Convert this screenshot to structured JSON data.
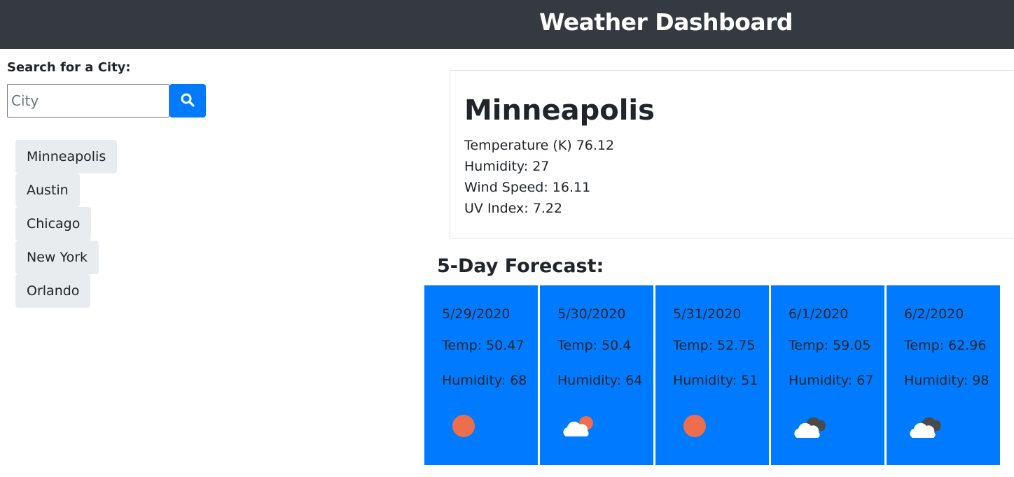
{
  "header": {
    "title": "Weather Dashboard"
  },
  "search": {
    "label": "Search for a City:",
    "placeholder": "City",
    "value": "",
    "button_icon": "search-icon"
  },
  "history": {
    "items": [
      {
        "label": "Minneapolis"
      },
      {
        "label": "Austin"
      },
      {
        "label": "Chicago"
      },
      {
        "label": "New York"
      },
      {
        "label": "Orlando"
      }
    ]
  },
  "current": {
    "city": "Minneapolis",
    "temperature": "Temperature (K) 76.12",
    "humidity": "Humidity: 27",
    "wind": "Wind Speed: 16.11",
    "uv": "UV Index: 7.22"
  },
  "forecast": {
    "title": "5-Day Forecast:",
    "days": [
      {
        "date": "5/29/2020",
        "temp": "Temp: 50.47",
        "humidity": "Humidity: 68",
        "icon": "sun-icon"
      },
      {
        "date": "5/30/2020",
        "temp": "Temp: 50.4",
        "humidity": "Humidity: 64",
        "icon": "partly-cloudy-icon"
      },
      {
        "date": "5/31/2020",
        "temp": "Temp: 52.75",
        "humidity": "Humidity: 51",
        "icon": "sun-icon"
      },
      {
        "date": "6/1/2020",
        "temp": "Temp: 59.05",
        "humidity": "Humidity: 67",
        "icon": "broken-clouds-icon"
      },
      {
        "date": "6/2/2020",
        "temp": "Temp: 62.96",
        "humidity": "Humidity: 98",
        "icon": "broken-clouds-icon"
      }
    ]
  },
  "colors": {
    "header_bg": "#343a40",
    "primary": "#007bff",
    "history_bg": "#e9ecef",
    "sun": "#ec6e4c",
    "cloud_dark": "#4a4a4a"
  }
}
